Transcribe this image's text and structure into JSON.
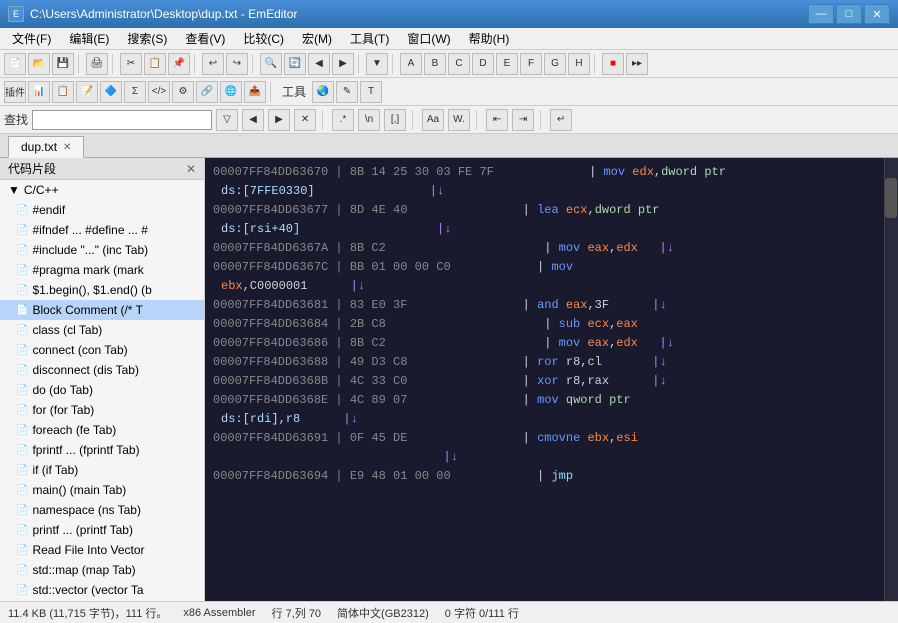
{
  "titleBar": {
    "title": "C:\\Users\\Administrator\\Desktop\\dup.txt - EmEditor",
    "icon": "📄",
    "minimizeLabel": "—",
    "maximizeLabel": "□",
    "closeLabel": "✕"
  },
  "menuBar": {
    "items": [
      "文件(F)",
      "编辑(E)",
      "搜索(S)",
      "查看(V)",
      "比较(C)",
      "宏(M)",
      "工具(T)",
      "窗口(W)",
      "帮助(H)"
    ]
  },
  "searchBar": {
    "label": "查找",
    "placeholder": ""
  },
  "tabs": [
    {
      "label": "dup.txt",
      "active": true
    }
  ],
  "sidebar": {
    "title": "代码片段",
    "rootLabel": "C/C++",
    "items": [
      "#endif",
      "#ifndef ... #define ... #",
      "#include \"...\" (inc Tab)",
      "#pragma mark (mark",
      "$1.begin(), $1.end() (b",
      "Block Comment (/* T",
      "class (cl Tab)",
      "connect (con Tab)",
      "disconnect (dis Tab)",
      "do (do Tab)",
      "for (for Tab)",
      "foreach (fe Tab)",
      "fprintf ... (fprintf Tab)",
      "if (if Tab)",
      "main() (main Tab)",
      "namespace (ns Tab)",
      "printf ... (printf Tab)",
      "Read File Into Vector",
      "std::map (map Tab)",
      "std::vector (vector Ta"
    ]
  },
  "codeLines": [
    {
      "addr": "00007FF84DD63670",
      "bytes": "| 8B 14 25 30 03 FE 7F",
      "pad": "           ",
      "instr": "| mov edx,dword ptr",
      "arrow": ""
    },
    {
      "addr": "ds:[7FFE0330]",
      "bytes": "",
      "pad": "",
      "instr": "  |↓",
      "arrow": ""
    },
    {
      "addr": "00007FF84DD63677",
      "bytes": "| 8D 4E 40",
      "pad": "",
      "instr": "| lea ecx,dword ptr",
      "arrow": ""
    },
    {
      "addr": "ds:[rsi+40]",
      "bytes": "",
      "pad": "",
      "instr": "  |↓",
      "arrow": ""
    },
    {
      "addr": "00007FF84DD6367A",
      "bytes": "| 8B C2",
      "pad": "",
      "instr": "| mov eax,edx",
      "arrow": "|↓"
    },
    {
      "addr": "00007FF84DD6367C",
      "bytes": "| BB 01 00 00 C0",
      "pad": "",
      "instr": "  | mov",
      "arrow": ""
    },
    {
      "addr": "ebx,C0000001",
      "bytes": "",
      "pad": "",
      "instr": "  |↓",
      "arrow": ""
    },
    {
      "addr": "00007FF84DD63681",
      "bytes": "| 83 E0 3F",
      "pad": "",
      "instr": "| and eax,3F",
      "arrow": "|↓"
    },
    {
      "addr": "00007FF84DD63684",
      "bytes": "| 2B C8",
      "pad": "",
      "instr": "| sub ecx,eax",
      "arrow": ""
    },
    {
      "addr": "00007FF84DD63686",
      "bytes": "| 8B C2",
      "pad": "",
      "instr": "| mov eax,edx",
      "arrow": "|↓"
    },
    {
      "addr": "00007FF84DD63688",
      "bytes": "| 49 D3 C8",
      "pad": "",
      "instr": "| ror r8,cl",
      "arrow": "|↓"
    },
    {
      "addr": "00007FF84DD6368B",
      "bytes": "| 4C 33 C0",
      "pad": "",
      "instr": "| xor r8,rax",
      "arrow": "|↓"
    },
    {
      "addr": "00007FF84DD6368E",
      "bytes": "| 4C 89 07",
      "pad": "",
      "instr": "| mov qword ptr",
      "arrow": ""
    },
    {
      "addr": "ds:[rdi],r8",
      "bytes": "",
      "pad": "",
      "instr": "  |↓",
      "arrow": ""
    },
    {
      "addr": "00007FF84DD63691",
      "bytes": "| 0F 45 DE",
      "pad": "",
      "instr": "| cmovne ebx,esi",
      "arrow": ""
    },
    {
      "addr": "",
      "bytes": "",
      "pad": "",
      "instr": "  |↓",
      "arrow": ""
    },
    {
      "addr": "00007FF84DD63694",
      "bytes": "| E9 48 01 00 00",
      "pad": "",
      "instr": "  | jmp",
      "arrow": ""
    }
  ],
  "statusBar": {
    "fileSize": "11.4 KB (11,715 字节)，111 行。",
    "encoding": "x86 Assembler",
    "position": "行 7,列 70",
    "charset": "简体中文(GB2312)",
    "selection": "0 字符 0/111 行"
  }
}
